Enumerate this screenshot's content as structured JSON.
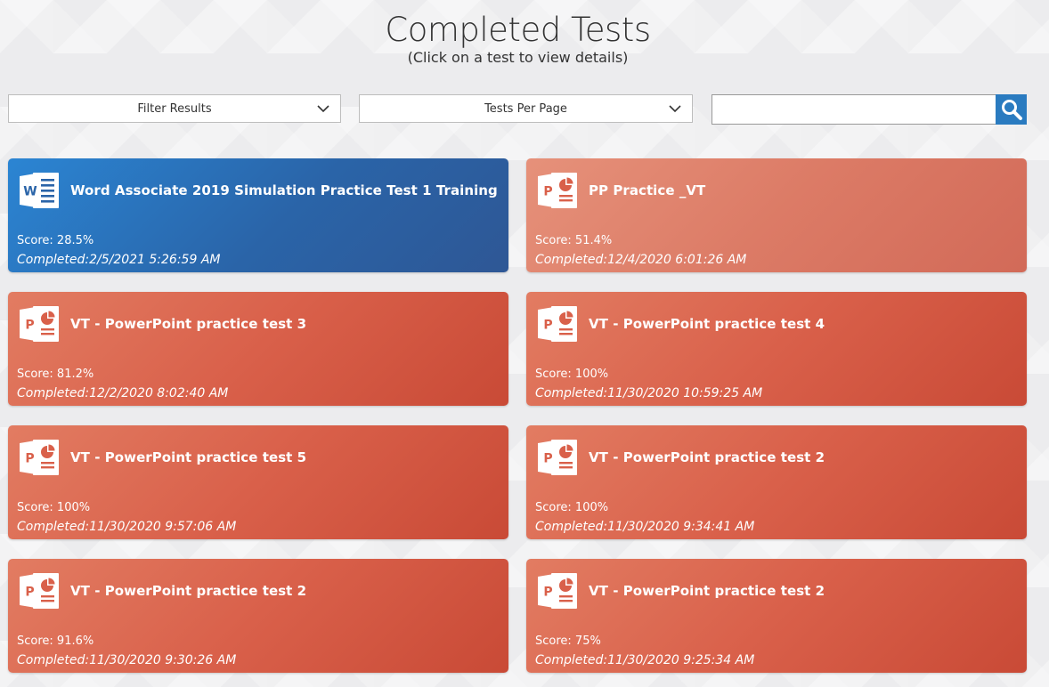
{
  "header": {
    "title": "Completed Tests",
    "subtitle": "(Click on a test to view details)"
  },
  "controls": {
    "filter_label": "Filter Results",
    "per_page_label": "Tests Per Page",
    "search_value": "",
    "search_icon": "magnifier-icon"
  },
  "colors": {
    "word_blue": "#2a64a8",
    "powerpoint_red": "#d9604a",
    "search_button": "#2a7bc0"
  },
  "cards": [
    {
      "app": "word",
      "icon": "word-app-icon",
      "title": "Word Associate 2019 Simulation Practice Test 1 Training",
      "score": "Score: 28.5%",
      "completed": "Completed:2/5/2021 5:26:59 AM"
    },
    {
      "app": "powerpoint",
      "icon": "powerpoint-app-icon",
      "title": "PP Practice _VT",
      "score": "Score: 51.4%",
      "completed": "Completed:12/4/2020 6:01:26 AM"
    },
    {
      "app": "powerpoint",
      "icon": "powerpoint-app-icon",
      "title": "VT - PowerPoint practice test 3",
      "score": "Score: 81.2%",
      "completed": "Completed:12/2/2020 8:02:40 AM"
    },
    {
      "app": "powerpoint",
      "icon": "powerpoint-app-icon",
      "title": "VT - PowerPoint practice test 4",
      "score": "Score: 100%",
      "completed": "Completed:11/30/2020 10:59:25 AM"
    },
    {
      "app": "powerpoint",
      "icon": "powerpoint-app-icon",
      "title": "VT - PowerPoint practice test 5",
      "score": "Score: 100%",
      "completed": "Completed:11/30/2020 9:57:06 AM"
    },
    {
      "app": "powerpoint",
      "icon": "powerpoint-app-icon",
      "title": "VT - PowerPoint practice test 2",
      "score": "Score: 100%",
      "completed": "Completed:11/30/2020 9:34:41 AM"
    },
    {
      "app": "powerpoint",
      "icon": "powerpoint-app-icon",
      "title": "VT - PowerPoint practice test 2",
      "score": "Score: 91.6%",
      "completed": "Completed:11/30/2020 9:30:26 AM"
    },
    {
      "app": "powerpoint",
      "icon": "powerpoint-app-icon",
      "title": "VT - PowerPoint practice test 2",
      "score": "Score: 75%",
      "completed": "Completed:11/30/2020 9:25:34 AM"
    }
  ]
}
